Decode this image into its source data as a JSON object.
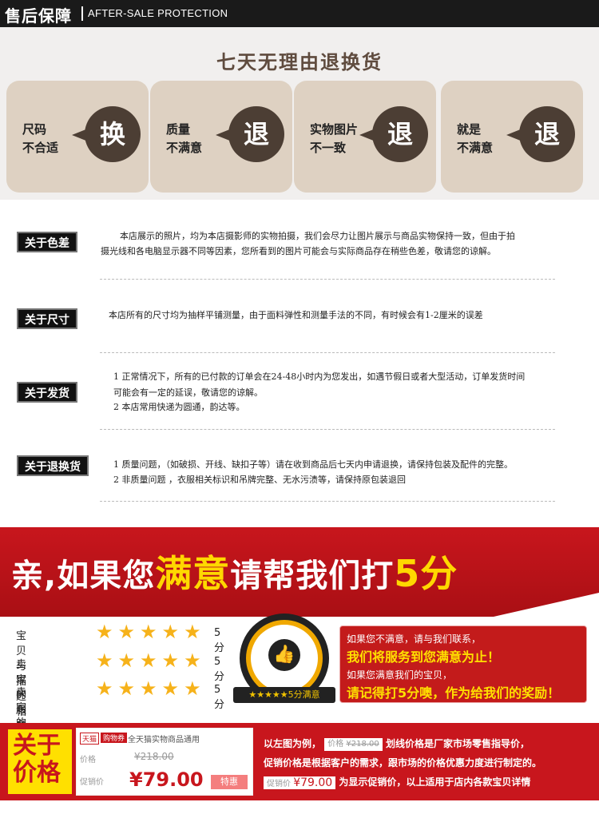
{
  "header": {
    "title_cn": "售后保障",
    "title_en": "AFTER-SALE PROTECTION"
  },
  "panel": {
    "title": "七天无理由退换货",
    "cards": [
      {
        "label_line1": "尺码",
        "label_line2": "不合适",
        "char": "换"
      },
      {
        "label_line1": "质量",
        "label_line2": "不满意",
        "char": "退"
      },
      {
        "label_line1": "实物图片",
        "label_line2": "不一致",
        "char": "退"
      },
      {
        "label_line1": "就是",
        "label_line2": "不满意",
        "char": "退"
      }
    ]
  },
  "info": {
    "color": {
      "badge": "关于色差",
      "line1": "本店展示的照片，均为本店摄影师的实物拍摄，我们会尽力让图片展示与商品实物保持一致，但由于拍",
      "line2": "摄光线和各电脑显示器不同等因素，您所看到的图片可能会与实际商品存在稍些色差，敬请您的谅解。"
    },
    "size": {
      "badge": "关于尺寸",
      "line1": "本店所有的尺寸均为抽样平铺测量，由于面料弹性和测量手法的不同，有时候会有1-2厘米的误差"
    },
    "shipping": {
      "badge": "关于发货",
      "line1": "1  正常情况下，所有的已付款的订单会在24-48小时内为您发出，如遇节假日或者大型活动，订单发货时间",
      "line2": "可能会有一定的延误，敬请您的谅解。",
      "line3": "2  本店常用快递为圆通，韵达等。"
    },
    "returns": {
      "badge": "关于退换货",
      "line1": "1  质量问题，（如破损、开线、缺扣子等）请在收到商品后七天内申请退换，请保持包装及配件的完整。",
      "line2": "2  非质量问题 ，衣服相关标识和吊牌完整、无水污渍等，请保持原包装退回"
    }
  },
  "banner": {
    "part1": "亲,如果您",
    "part2": "满意",
    "part3": "请帮我们打",
    "part4": "5分"
  },
  "ratings": [
    {
      "label": "宝贝与描述相符",
      "stars": 5,
      "score": "5分"
    },
    {
      "label": "卖家的服务态度",
      "stars": 5,
      "score": "5分"
    },
    {
      "label": "卖家的发货速度",
      "stars": 5,
      "score": "5分"
    }
  ],
  "medal": {
    "ribbon": "★★★★★5分满意"
  },
  "message": {
    "line1": "如果您不满意，请与我们联系，",
    "line2": "我们将服务到您满意为止！",
    "line3": "如果您满意我们的宝贝，",
    "line4": "请记得打5分噢，作为给我们的奖励！"
  },
  "price": {
    "box_line1": "关于",
    "box_line2": "价格",
    "card": {
      "tmall": "天猫",
      "coupon": "购物券",
      "desc": "全天猫实物商品通用",
      "list_label": "价格",
      "list_value": "¥218.00",
      "promo_label": "促销价",
      "promo_value": "¥79.00",
      "tag": "特惠"
    },
    "explain": {
      "t1": "以左图为例，",
      "c1_label": "价格",
      "c1_value": "¥218.00",
      "t2": "划线价格是厂家市场零售指导价，",
      "t3": "促销价格是根据客户的需求，跟市场的价格优惠力度进行制定的。",
      "c2_label": "促销价",
      "c2_value": "¥79.00",
      "t4": "为显示促销价，以上适用于店内各款宝贝详情"
    }
  },
  "colors": {
    "dark": "#1a1a1a",
    "brown": "#4c3e34",
    "beige": "#ded1c2",
    "red": "#c8161d",
    "yellow": "#ffd800"
  }
}
